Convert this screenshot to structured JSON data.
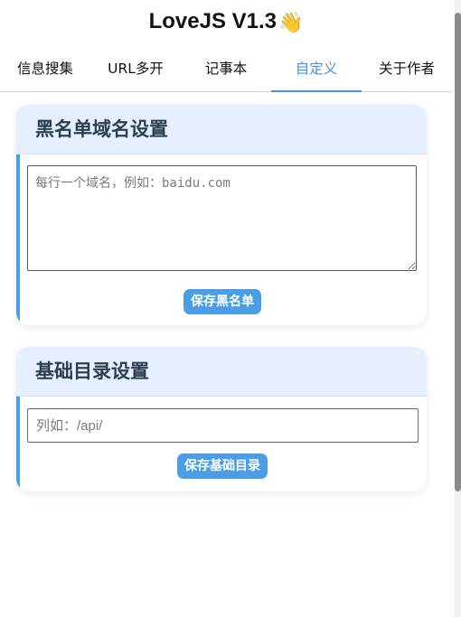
{
  "app": {
    "title": "LoveJS V1.3",
    "title_icon": "waving-hand-icon"
  },
  "tabs": [
    {
      "label": "信息搜集",
      "active": false
    },
    {
      "label": "URL多开",
      "active": false
    },
    {
      "label": "记事本",
      "active": false
    },
    {
      "label": "自定义",
      "active": true
    },
    {
      "label": "关于作者",
      "active": false
    }
  ],
  "blacklist": {
    "title": "黑名单域名设置",
    "placeholder": "每行一个域名，例如：baidu.com",
    "value": "",
    "save_label": "保存黑名单"
  },
  "base_dir": {
    "title": "基础目录设置",
    "placeholder": "列如：/api/",
    "value": "",
    "save_label": "保存基础目录"
  },
  "colors": {
    "accent": "#4a9ee8",
    "tab_active": "#4a90e2",
    "card_header_bg": "#e6effd"
  }
}
